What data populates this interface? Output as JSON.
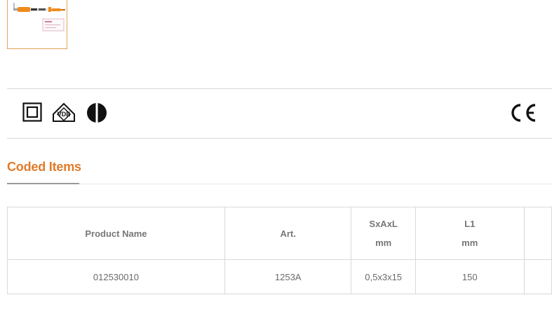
{
  "section": {
    "title": "Coded Items"
  },
  "certifications": [
    {
      "icon": "double-insulation-icon"
    },
    {
      "icon": "vde-mark-icon"
    },
    {
      "icon": "ip-protection-icon"
    },
    {
      "icon": "ce-mark-icon",
      "text": "CE"
    }
  ],
  "table": {
    "headers": {
      "product_name": "Product Name",
      "art": "Art.",
      "sxaxl": "SxAxL",
      "sxaxl_unit": "mm",
      "l1": "L1",
      "l1_unit": "mm"
    },
    "rows": [
      {
        "product_name": "012530010",
        "art": "1253A",
        "sxaxl": "0,5x3x15",
        "l1": "150"
      }
    ]
  },
  "colors": {
    "accent": "#e07b2a",
    "thumbnail_border": "#e8a25a",
    "divider": "#d8d8d8",
    "table_border": "#d9d9d9"
  }
}
